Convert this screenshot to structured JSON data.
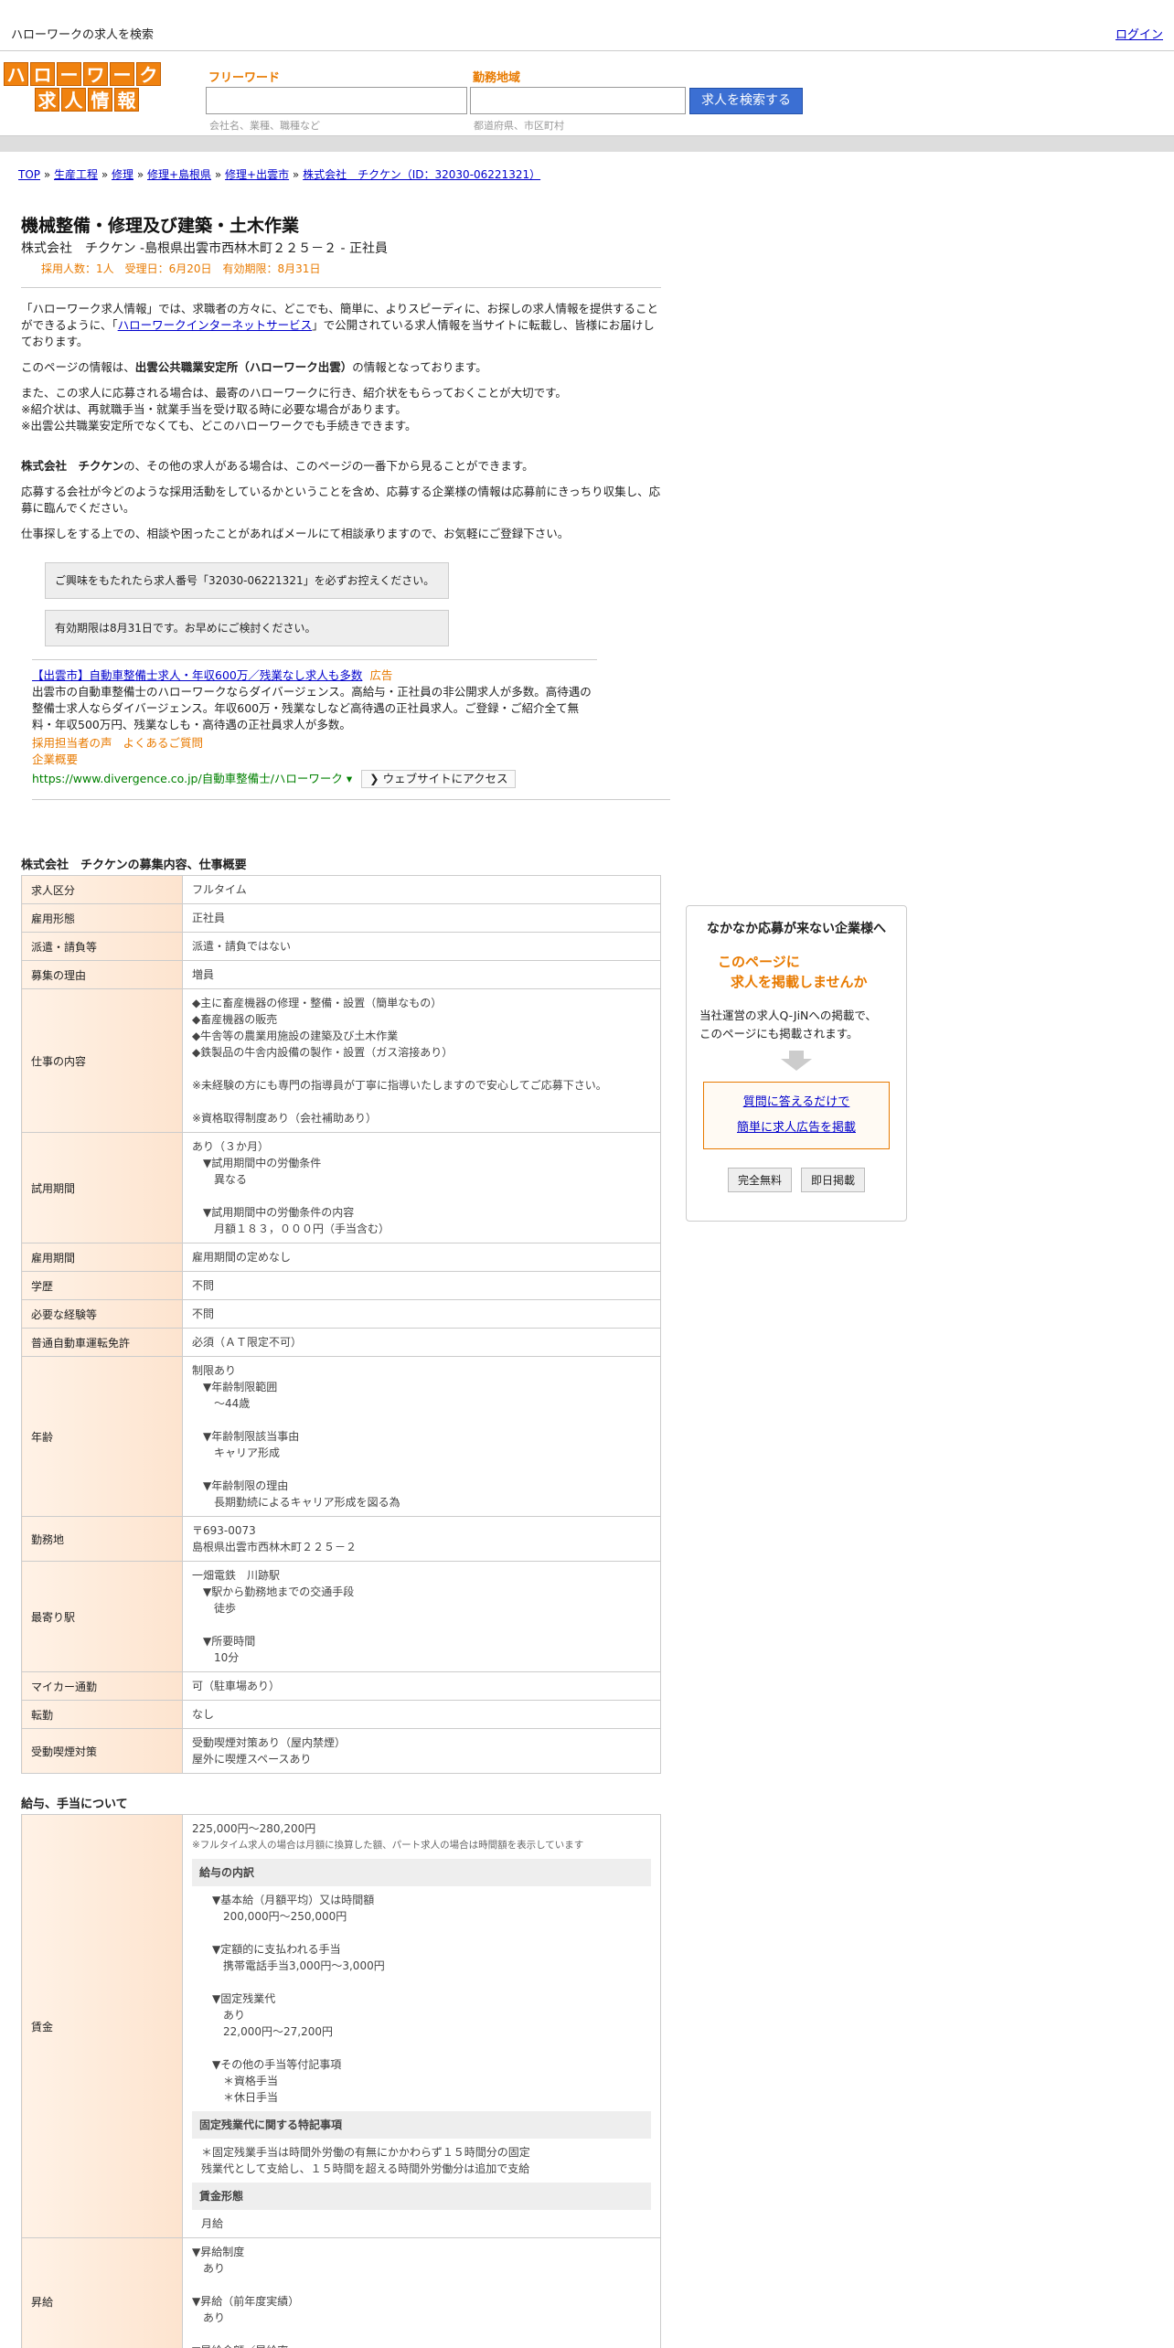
{
  "header": {
    "title": "ハローワークの求人を検索",
    "login": "ログイン"
  },
  "logo": {
    "row1": [
      "ハ",
      "ロ",
      "ー",
      "ワ",
      "ー",
      "ク"
    ],
    "row2": [
      "求",
      "人",
      "情",
      "報"
    ]
  },
  "search": {
    "free_label": "フリーワード",
    "free_hint": "会社名、業種、職種など",
    "area_label": "勤務地域",
    "area_hint": "都道府県、市区町村",
    "button": "求人を検索する"
  },
  "breadcrumb": {
    "items": [
      "TOP",
      "生産工程",
      "修理",
      "修理+島根県",
      "修理+出雲市",
      "株式会社　チクケン（ID：32030-06221321）"
    ],
    "sep": " » "
  },
  "job": {
    "title": "機械整備・修理及び建築・土木作業",
    "subtitle": "株式会社　チクケン -島根県出雲市西林木町２２５－２ - 正社員",
    "dates": "採用人数：1人　受理日：6月20日　有効期限：8月31日"
  },
  "intro": {
    "p1_a": "「ハローワーク求人情報」では、求職者の方々に、どこでも、簡単に、よりスピーディに、お探しの求人情報を提供することができるように、「",
    "p1_link": "ハローワークインターネットサービス",
    "p1_b": "」で公開されている求人情報を当サイトに転載し、皆様にお届けしております。",
    "p2_a": "このページの情報は、",
    "p2_bold": "出雲公共職業安定所（ハローワーク出雲）",
    "p2_b": "の情報となっております。",
    "p3_1": "また、この求人に応募される場合は、最寄のハローワークに行き、紹介状をもらっておくことが大切です。",
    "p3_2": "※紹介状は、再就職手当・就業手当を受け取る時に必要な場合があります。",
    "p3_3": "※出雲公共職業安定所でなくても、どこのハローワークでも手続きできます。",
    "p4_bold": "株式会社　チクケン",
    "p4": "の、その他の求人がある場合は、このページの一番下から見ることができます。",
    "p5": "応募する会社が今どのような採用活動をしているかということを含め、応募する企業様の情報は応募前にきっちり収集し、応募に臨んでください。",
    "p6": "仕事探しをする上での、相談や困ったことがあればメールにて相談承りますので、お気軽にご登録下さい。"
  },
  "notes": {
    "n1": "ご興味をもたれたら求人番号「32030-06221321」を必ずお控えください。",
    "n2": "有効期限は8月31日です。お早めにご検討ください。"
  },
  "ad": {
    "title": "【出雲市】自動車整備士求人・年収600万／残業なし求人も多数",
    "badge": "広告",
    "body": "出雲市の自動車整備士のハローワークならダイバージェンス。高給与・正社員の非公開求人が多数。高待遇の整備士求人ならダイバージェンス。年収600万・残業なしなど高待遇の正社員求人。ご登録・ご紹介全て無料・年収500万円、残業なしも・高待遇の正社員求人が多数。",
    "link1": "採用担当者の声",
    "link2": "よくあるご質問",
    "link3": "企業概要",
    "url": "https://www.divergence.co.jp/自動車整備士/ハローワーク",
    "url_arrow": "▾",
    "access": "❯ ウェブサイトにアクセス"
  },
  "section1": {
    "title": "株式会社　チクケンの募集内容、仕事概要",
    "rows": [
      {
        "h": "求人区分",
        "v": [
          "フルタイム"
        ]
      },
      {
        "h": "雇用形態",
        "v": [
          "正社員"
        ]
      },
      {
        "h": "派遣・請負等",
        "v": [
          "派遣・請負ではない"
        ]
      },
      {
        "h": "募集の理由",
        "v": [
          "増員"
        ]
      },
      {
        "h": "仕事の内容",
        "v": [
          "◆主に畜産機器の修理・整備・設置（簡単なもの）",
          "◆畜産機器の販売",
          "◆牛舎等の農業用施設の建築及び土木作業",
          "◆鉄製品の牛舎内設備の製作・設置（ガス溶接あり）",
          "",
          "※未経験の方にも専門の指導員が丁寧に指導いたしますので安心してご応募下さい。",
          "",
          "※資格取得制度あり（会社補助あり）"
        ]
      },
      {
        "h": "試用期間",
        "v": [
          "あり（３か月）",
          "　▼試用期間中の労働条件",
          "　　異なる",
          "",
          "　▼試用期間中の労働条件の内容",
          "　　月額１８３，０００円（手当含む）"
        ]
      },
      {
        "h": "雇用期間",
        "v": [
          "雇用期間の定めなし"
        ]
      },
      {
        "h": "学歴",
        "v": [
          "不問"
        ]
      },
      {
        "h": "必要な経験等",
        "v": [
          "不問"
        ]
      },
      {
        "h": "普通自動車運転免許",
        "v": [
          "必須（ＡＴ限定不可）"
        ]
      },
      {
        "h": "年齢",
        "v": [
          "制限あり",
          "　▼年齢制限範囲",
          "　　〜44歳",
          "",
          "　▼年齢制限該当事由",
          "　　キャリア形成",
          "",
          "　▼年齢制限の理由",
          "　　長期勤続によるキャリア形成を図る為"
        ]
      },
      {
        "h": "勤務地",
        "v": [
          "〒693-0073",
          "島根県出雲市西林木町２２５－２"
        ]
      },
      {
        "h": "最寄り駅",
        "v": [
          "一畑電鉄　川跡駅",
          "　▼駅から勤務地までの交通手段",
          "　　徒歩",
          "",
          "　▼所要時間",
          "　　10分"
        ]
      },
      {
        "h": "マイカー通勤",
        "v": [
          "可（駐車場あり）"
        ]
      },
      {
        "h": "転勤",
        "v": [
          "なし"
        ]
      },
      {
        "h": "受動喫煙対策",
        "v": [
          "受動喫煙対策あり（屋内禁煙）",
          "屋外に喫煙スペースあり"
        ]
      }
    ]
  },
  "section2": {
    "title": "給与、手当について",
    "wage_label": "賃金",
    "wage_range": "225,000円〜280,200円",
    "wage_note": "※フルタイム求人の場合は月額に換算した額、パート求人の場合は時間額を表示しています",
    "breakdown_title": "給与の内訳",
    "breakdown": [
      "　▼基本給（月額平均）又は時間額",
      "　　200,000円〜250,000円",
      "",
      "　▼定額的に支払われる手当",
      "　　携帯電話手当3,000円〜3,000円",
      "",
      "　▼固定残業代",
      "　　あり",
      "　　22,000円〜27,200円",
      "",
      "　▼その他の手当等付記事項",
      "　　＊資格手当",
      "　　＊休日手当"
    ],
    "fixed_title": "固定残業代に関する特記事項",
    "fixed_text": [
      "＊固定残業手当は時間外労働の有無にかかわらず１５時間分の固定",
      "残業代として支給し、１５時間を超える時間外労働分は追加で支給"
    ],
    "form_title": "賃金形態",
    "form_value": "月給",
    "raise_label": "昇給",
    "raise": [
      "▼昇給制度",
      "　あり",
      "",
      "▼昇給（前年度実績）",
      "　あり",
      "",
      "▼昇給金額／昇給率"
    ]
  },
  "sidebar": {
    "title": "なかなか応募が来ない企業様へ",
    "catch1": "このページに",
    "catch2": "求人を掲載しませんか",
    "desc1": "当社運営の求人Q-JiNへの掲載で、",
    "desc2": "このページにも掲載されます。",
    "link1": "質問に答えるだけで",
    "link2": "簡単に求人広告を掲載",
    "btn1": "完全無料",
    "btn2": "即日掲載"
  }
}
